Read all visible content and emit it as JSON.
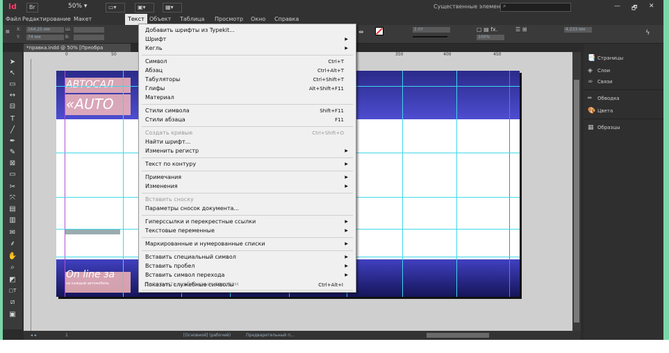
{
  "titlebar": {
    "logo": "Id",
    "zoom": "50% ▾",
    "br_label": "Br",
    "essentials": "Существенные элементы  ▾",
    "win_min": "—",
    "win_max": "🗗",
    "win_close": "✕"
  },
  "menubar": {
    "items": [
      "Файл",
      "Редактирование",
      "Макет",
      "Текст",
      "Объект",
      "Таблица",
      "Просмотр",
      "Окно",
      "Справка"
    ],
    "active": "Текст"
  },
  "controlbar": {
    "x_label": "X:",
    "x_value": "164,25 мм",
    "y_label": "Y:",
    "y_value": "74 мм",
    "w_label": "Ш:",
    "h_label": "В:",
    "stroke": "1 пт",
    "opacity": "100%",
    "measure": "4,233 мм"
  },
  "document": {
    "tab": "*правка.indd @ 50% [Преобра",
    "ruler_ticks": [
      "0",
      "50",
      "350",
      "400",
      "450"
    ],
    "page_text_1": "АВТОСАЛ",
    "page_text_2": "«AUTO",
    "page_text_3": "On line за",
    "page_text_4": "на каждый автомобиль"
  },
  "statusbar": {
    "page": "1",
    "style": "[Основной] (рабочий)",
    "preflight": "Предварительный п..."
  },
  "panels": [
    {
      "icon": "📑",
      "label": "Страницы"
    },
    {
      "icon": "◈",
      "label": "Слои"
    },
    {
      "icon": "∞",
      "label": "Связи"
    },
    {
      "icon": "═",
      "label": "Обводка"
    },
    {
      "icon": "🎨",
      "label": "Цвета"
    },
    {
      "icon": "▦",
      "label": "Образцы"
    }
  ],
  "menu": {
    "add_typekit": "Добавить шрифты из Typekit...",
    "font": "Шрифт",
    "size": "Кегль",
    "character": "Символ",
    "character_sc": "Ctrl+T",
    "paragraph": "Абзац",
    "paragraph_sc": "Ctrl+Alt+T",
    "tabs": "Табуляторы",
    "tabs_sc": "Ctrl+Shift+T",
    "glyphs": "Глифы",
    "glyphs_sc": "Alt+Shift+F11",
    "story": "Материал",
    "char_styles": "Стили символа",
    "char_styles_sc": "Shift+F11",
    "para_styles": "Стили абзаца",
    "para_styles_sc": "F11",
    "create_outlines": "Создать кривые",
    "create_outlines_sc": "Ctrl+Shift+O",
    "find_font": "Найти шрифт...",
    "change_case": "Изменить регистр",
    "type_on_path": "Текст по контуру",
    "notes": "Примечания",
    "track_changes": "Изменения",
    "insert_footnote": "Вставить сноску",
    "footnote_options": "Параметры сносок документа...",
    "hyperlinks": "Гиперссылки и перекрестные ссылки",
    "text_variables": "Текстовые переменные",
    "bullets": "Маркированные и нумерованные списки",
    "insert_special": "Вставить специальный символ",
    "insert_space": "Вставить пробел",
    "insert_break": "Вставить символ перехода",
    "fill_placeholder": "Заполнить шаблонным текстом",
    "show_hidden": "Показать служебные символы",
    "show_hidden_sc": "Ctrl+Alt+I"
  }
}
